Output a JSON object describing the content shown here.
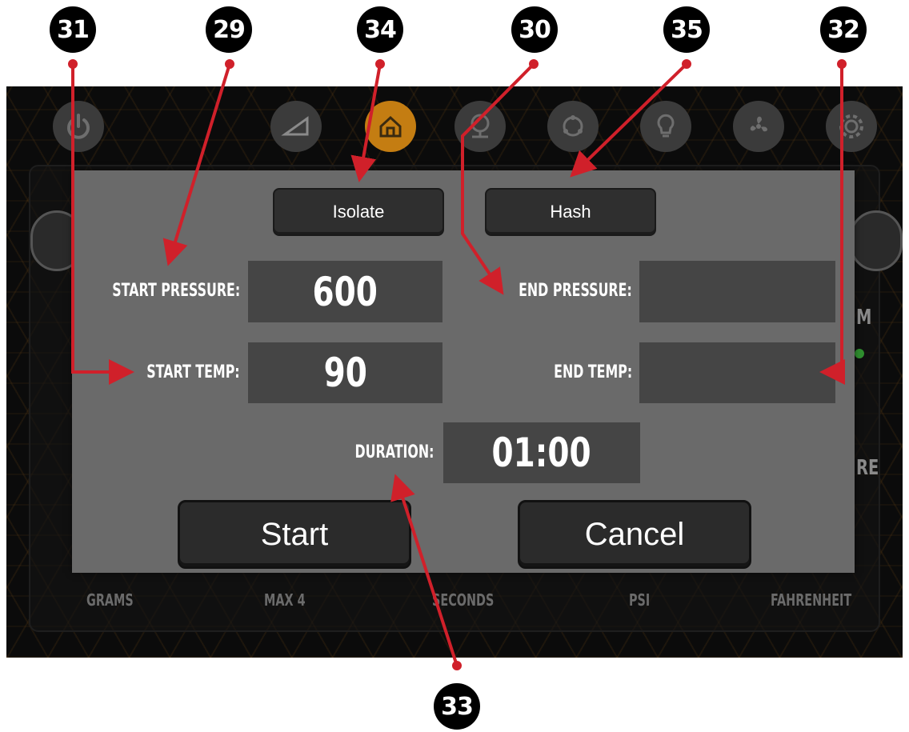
{
  "callouts": [
    "31",
    "29",
    "34",
    "30",
    "35",
    "32",
    "33"
  ],
  "nav_icons": [
    "power-icon",
    "ramp-icon",
    "home-icon",
    "pump-icon",
    "cycle-icon",
    "bulb-icon",
    "fan-icon",
    "gear-icon"
  ],
  "background": {
    "unit_labels": [
      "GRAMS",
      "MAX 4",
      "SECONDS",
      "PSI",
      "FAHRENHEIT"
    ],
    "fragments": [
      "M",
      "RE"
    ]
  },
  "dialog": {
    "isolate_label": "Isolate",
    "hash_label": "Hash",
    "start_pressure_label": "START PRESSURE:",
    "start_pressure_value": "600",
    "end_pressure_label": "END PRESSURE:",
    "end_pressure_value": "",
    "start_temp_label": "START TEMP:",
    "start_temp_value": "90",
    "end_temp_label": "END TEMP:",
    "end_temp_value": "",
    "duration_label": "DURATION:",
    "duration_value": "01:00",
    "start_button": "Start",
    "cancel_button": "Cancel"
  },
  "colors": {
    "annotation_arrow": "#d0202a",
    "active_nav": "#c47d12",
    "dialog_bg": "#6a6a6a",
    "value_box_bg": "#454545"
  }
}
